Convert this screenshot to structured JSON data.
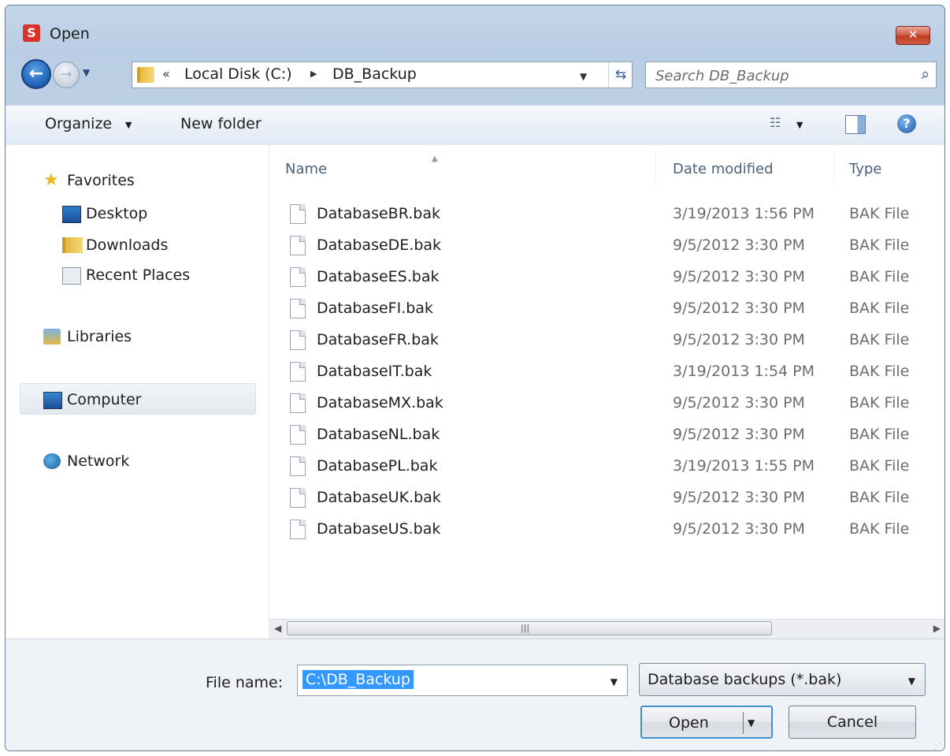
{
  "window": {
    "title": "Open",
    "app_icon_letter": "S",
    "close_glyph": "✕"
  },
  "nav": {
    "back_glyph": "←",
    "forward_glyph": "→",
    "breadcrumb_chevron": "«",
    "breadcrumb": [
      "Local Disk (C:)",
      "DB_Backup"
    ],
    "crumb_arrow": "▶",
    "refresh_glyph": "⇆",
    "search_placeholder": "Search DB_Backup"
  },
  "toolbar": {
    "organize": "Organize",
    "new_folder": "New folder",
    "view_glyph": "☷",
    "help_glyph": "?"
  },
  "sidebar": {
    "favorites": "Favorites",
    "desktop": "Desktop",
    "downloads": "Downloads",
    "recent": "Recent Places",
    "libraries": "Libraries",
    "computer": "Computer",
    "network": "Network"
  },
  "columns": {
    "name": "Name",
    "date": "Date modified",
    "type": "Type"
  },
  "files": [
    {
      "name": "DatabaseBR.bak",
      "date": "3/19/2013 1:56 PM",
      "type": "BAK File"
    },
    {
      "name": "DatabaseDE.bak",
      "date": "9/5/2012 3:30 PM",
      "type": "BAK File"
    },
    {
      "name": "DatabaseES.bak",
      "date": "9/5/2012 3:30 PM",
      "type": "BAK File"
    },
    {
      "name": "DatabaseFI.bak",
      "date": "9/5/2012 3:30 PM",
      "type": "BAK File"
    },
    {
      "name": "DatabaseFR.bak",
      "date": "9/5/2012 3:30 PM",
      "type": "BAK File"
    },
    {
      "name": "DatabaseIT.bak",
      "date": "3/19/2013 1:54 PM",
      "type": "BAK File"
    },
    {
      "name": "DatabaseMX.bak",
      "date": "9/5/2012 3:30 PM",
      "type": "BAK File"
    },
    {
      "name": "DatabaseNL.bak",
      "date": "9/5/2012 3:30 PM",
      "type": "BAK File"
    },
    {
      "name": "DatabasePL.bak",
      "date": "3/19/2013 1:55 PM",
      "type": "BAK File"
    },
    {
      "name": "DatabaseUK.bak",
      "date": "9/5/2012 3:30 PM",
      "type": "BAK File"
    },
    {
      "name": "DatabaseUS.bak",
      "date": "9/5/2012 3:30 PM",
      "type": "BAK File"
    }
  ],
  "footer": {
    "file_name_label": "File name:",
    "file_name_value": "C:\\DB_Backup",
    "filter": "Database backups (*.bak)",
    "open": "Open",
    "cancel": "Cancel"
  },
  "colors": {
    "selection": "#3399ff",
    "frame": "#bdd0e5",
    "close": "#c0391f"
  }
}
